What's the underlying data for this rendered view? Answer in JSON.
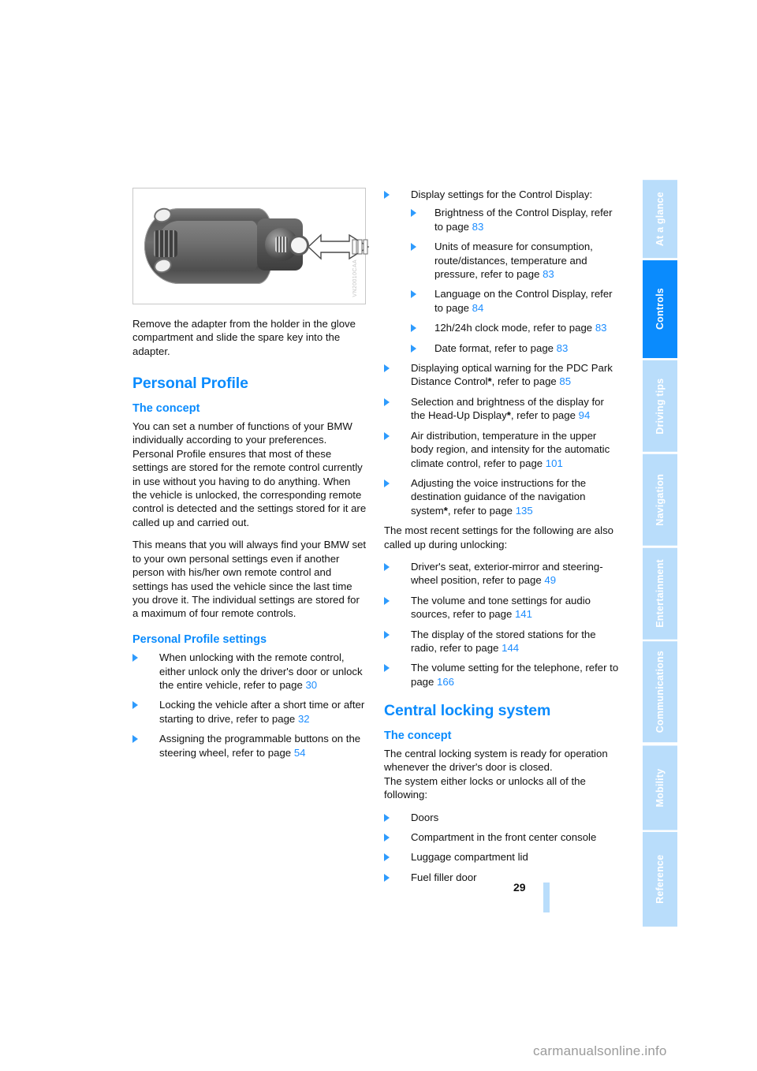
{
  "document": {
    "page_number": "29",
    "watermark": "carmanualsonline.info"
  },
  "sidebar": {
    "tabs": [
      {
        "label": "At a glance",
        "active": false
      },
      {
        "label": "Controls",
        "active": true
      },
      {
        "label": "Driving tips",
        "active": false
      },
      {
        "label": "Navigation",
        "active": false
      },
      {
        "label": "Entertainment",
        "active": false
      },
      {
        "label": "Communications",
        "active": false
      },
      {
        "label": "Mobility",
        "active": false
      },
      {
        "label": "Reference",
        "active": false
      }
    ],
    "active_color": "#0a8bfd",
    "inactive_color": "#b9ddfb"
  },
  "figure": {
    "code": "VN20010CAA",
    "alt": "Remote control key with adapter and spare key arrow"
  },
  "left_column": {
    "intro_paragraph": "Remove the adapter from the holder in the glove compartment and slide the spare key into the adapter.",
    "heading": "Personal Profile",
    "concept_heading": "The concept",
    "concept_p1": "You can set a number of functions of your BMW individually according to your preferences. Personal Profile ensures that most of these settings are stored for the remote control currently in use without you having to do anything. When the vehicle is unlocked, the corresponding remote control is detected and the settings stored for it are called up and carried out.",
    "concept_p2": "This means that you will always find your BMW set to your own personal settings even if another person with his/her own remote control and settings has used the vehicle since the last time you drove it. The individual settings are stored for a maximum of four remote controls.",
    "settings_heading": "Personal Profile settings",
    "settings_items": [
      {
        "text": "When unlocking with the remote control, either unlock only the driver's door or unlock the entire vehicle, refer to page ",
        "page": "30"
      },
      {
        "text": "Locking the vehicle after a short time or after starting to drive, refer to page ",
        "page": "32"
      },
      {
        "text": "Assigning the programmable buttons on the steering wheel, refer to page ",
        "page": "54"
      }
    ]
  },
  "right_column": {
    "display_settings_lead": "Display settings for the Control Display:",
    "display_settings_sub": [
      {
        "text": "Brightness of the Control Display, refer to page ",
        "page": "83"
      },
      {
        "text": "Units of measure for consumption, route/distances, temperature and pressure, refer to page ",
        "page": "83"
      },
      {
        "text": "Language on the Control Display, refer to page ",
        "page": "84"
      },
      {
        "text": "12h/24h clock mode, refer to page ",
        "page": "83"
      },
      {
        "text": "Date format, refer to page ",
        "page": "83"
      }
    ],
    "more_items": [
      {
        "text": "Displaying optical warning for the PDC Park Distance Control",
        "asterisk": "*",
        "text2": ", refer to page ",
        "page": "85"
      },
      {
        "text": "Selection and brightness of the display for the Head-Up Display",
        "asterisk": "*",
        "text2": ", refer to page ",
        "page": "94"
      },
      {
        "text": "Air distribution, temperature in the upper body region, and intensity for the automatic climate control, refer to page ",
        "asterisk": "",
        "text2": "",
        "page": "101"
      },
      {
        "text": "Adjusting the voice instructions for the destination guidance of the navigation system",
        "asterisk": "*",
        "text2": ", refer to page ",
        "page": "135"
      }
    ],
    "recent_lead": "The most recent settings for the following are also called up during unlocking:",
    "recent_items": [
      {
        "text": "Driver's seat, exterior-mirror and steering-wheel position, refer to page ",
        "page": "49"
      },
      {
        "text": "The volume and tone settings for audio sources, refer to page ",
        "page": "141"
      },
      {
        "text": "The display of the stored stations for the radio, refer to page ",
        "page": "144"
      },
      {
        "text": "The volume setting for the telephone, refer to page ",
        "page": "166"
      }
    ],
    "central_heading": "Central locking system",
    "central_concept_heading": "The concept",
    "central_concept_p1": "The central locking system is ready for operation whenever the driver's door is closed.",
    "central_concept_p2": "The system either locks or unlocks all of the following:",
    "central_items": [
      {
        "text": "Doors"
      },
      {
        "text": "Compartment in the front center console"
      },
      {
        "text": "Luggage compartment lid"
      },
      {
        "text": "Fuel filler door"
      }
    ]
  }
}
